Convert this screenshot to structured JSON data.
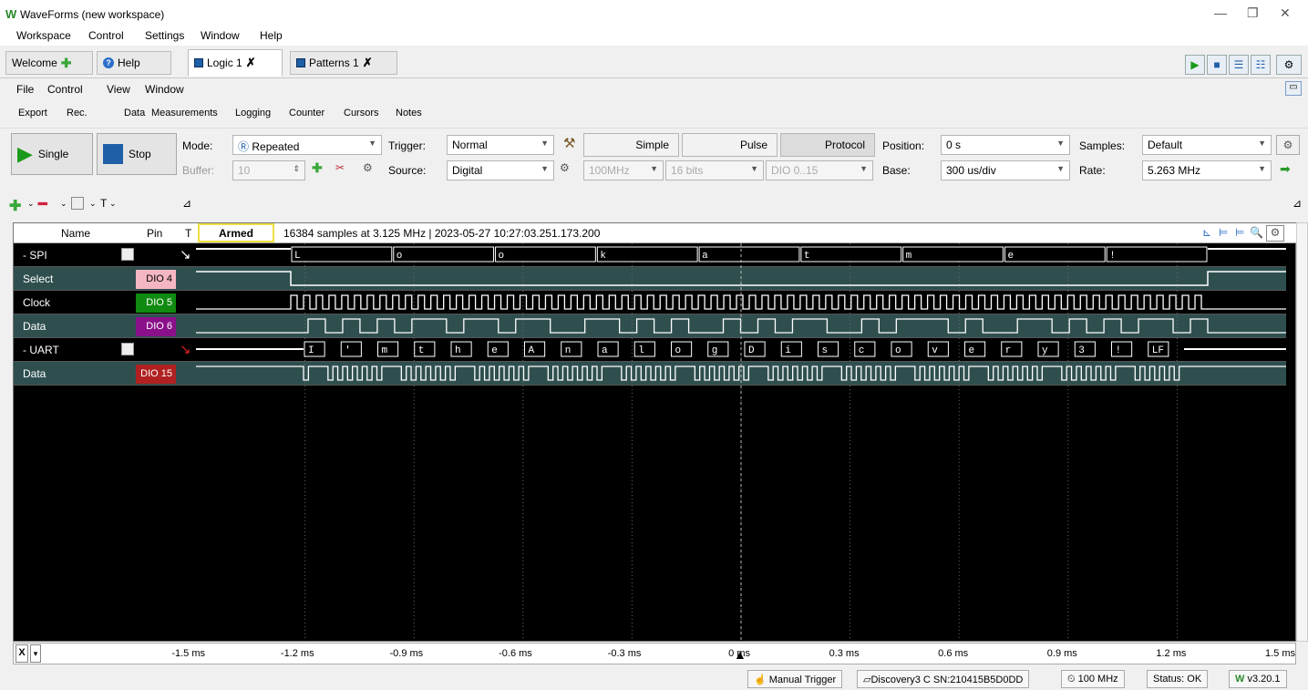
{
  "window": {
    "title": "WaveForms (new workspace)"
  },
  "main_menu": [
    "Workspace",
    "Control",
    "Settings",
    "Window",
    "Help"
  ],
  "tabs": [
    {
      "label": "Welcome"
    },
    {
      "label": "Help"
    },
    {
      "label": "Logic 1"
    },
    {
      "label": "Patterns 1"
    }
  ],
  "doc_menu": [
    "File",
    "Control",
    "View",
    "Window"
  ],
  "sub_toolbar": [
    "Export",
    "Rec.",
    "Data",
    "Measurements",
    "Logging",
    "Counter",
    "Cursors",
    "Notes"
  ],
  "controls": {
    "single_label": "Single",
    "stop_label": "Stop",
    "mode_label": "Mode:",
    "mode_value": "Repeated",
    "buffer_label": "Buffer:",
    "buffer_value": "10",
    "trigger_label": "Trigger:",
    "trigger_value": "Normal",
    "source_label": "Source:",
    "source_value": "Digital",
    "simple_label": "Simple",
    "pulse_label": "Pulse",
    "protocol_label": "Protocol",
    "rate_select": "100MHz",
    "bits_select": "16 bits",
    "dio_select": "DIO 0..15",
    "position_label": "Position:",
    "position_value": "0 s",
    "base_label": "Base:",
    "base_value": "300 us/div",
    "samples_label": "Samples:",
    "samples_value": "Default",
    "rate_label": "Rate:",
    "rate_value": "5.263 MHz"
  },
  "grid_header": {
    "name_col": "Name",
    "pin_col": "Pin",
    "t_col": "T",
    "status": "Armed",
    "info": "16384 samples at 3.125 MHz | 2023-05-27 10:27:03.251.173.200"
  },
  "channels": [
    {
      "name": "- SPI",
      "pin": "",
      "color": "#000000",
      "pin_color": ""
    },
    {
      "name": "Select",
      "pin": "DIO 4",
      "color": "#2f4f4f",
      "pin_color": "#f4b6c2"
    },
    {
      "name": "Clock",
      "pin": "DIO 5",
      "color": "#000000",
      "pin_color": "#108a10"
    },
    {
      "name": "Data",
      "pin": "DIO 6",
      "color": "#2f4f4f",
      "pin_color": "#8a108a"
    },
    {
      "name": "- UART",
      "pin": "",
      "color": "#000000",
      "pin_color": ""
    },
    {
      "name": "Data",
      "pin": "DIO 15",
      "color": "#2f4f4f",
      "pin_color": "#b02020"
    }
  ],
  "spi_decoded": [
    "L",
    "o",
    "o",
    "k",
    "a",
    "t",
    "m",
    "e",
    "!"
  ],
  "uart_decoded": [
    "I",
    "'",
    "m",
    "t",
    "h",
    "e",
    "A",
    "n",
    "a",
    "l",
    "o",
    "g",
    "D",
    "i",
    "s",
    "c",
    "o",
    "v",
    "e",
    "r",
    "y",
    "3",
    "!",
    "LF"
  ],
  "x_axis": {
    "tick_labels": [
      "-1.5 ms",
      "-1.2 ms",
      "-0.9 ms",
      "-0.6 ms",
      "-0.3 ms",
      "0 ms",
      "0.3 ms",
      "0.6 ms",
      "0.9 ms",
      "1.2 ms",
      "1.5 ms"
    ],
    "axis_button": "X"
  },
  "status_bar": {
    "manual_trigger": "Manual Trigger",
    "device": "Discovery3 C SN:210415B5D0DD",
    "clock": "100 MHz",
    "status": "Status: OK",
    "version": "v3.20.1"
  }
}
